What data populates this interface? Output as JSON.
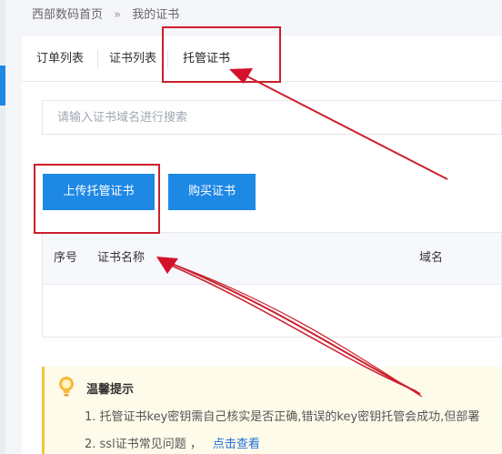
{
  "breadcrumb": {
    "home": "西部数码首页",
    "separator": "»",
    "current": "我的证书"
  },
  "tabs": [
    {
      "label": "订单列表"
    },
    {
      "label": "证书列表"
    },
    {
      "label": "托管证书",
      "active": true
    }
  ],
  "search": {
    "placeholder": "请输入证书域名进行搜索"
  },
  "buttons": {
    "upload": "上传托管证书",
    "buy": "购买证书"
  },
  "table": {
    "headers": [
      "序号",
      "证书名称",
      "域名"
    ]
  },
  "tips": {
    "title": "温馨提示",
    "line1": "1. 托管证书key密钥需自己核实是否正确,错误的key密钥托管会成功,但部署",
    "line2_prefix": "2. ssl证书常见问题 ，",
    "line2_link": "点击查看"
  },
  "colors": {
    "accent": "#1e88e5",
    "annotation": "#cc1f2d",
    "tip_border": "#f4c53b",
    "tip_bg": "#fffbea"
  }
}
